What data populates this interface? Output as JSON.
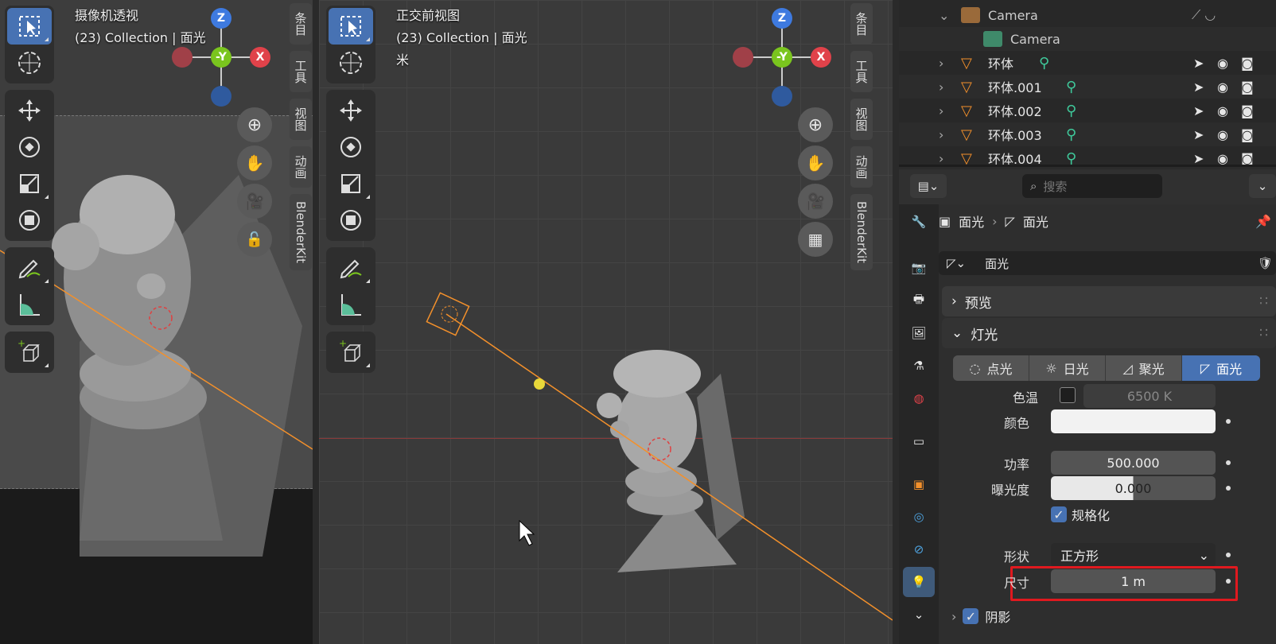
{
  "left_viewport": {
    "title": "摄像机透视",
    "subtitle": "(23) Collection | 面光",
    "side_tabs": [
      "条目",
      "工具",
      "视图",
      "动画",
      "BlenderKit"
    ]
  },
  "mid_viewport": {
    "title": "正交前视图",
    "subtitle": "(23) Collection | 面光",
    "unit": "米",
    "side_tabs": [
      "条目",
      "工具",
      "视图",
      "动画",
      "BlenderKit"
    ]
  },
  "gizmo": {
    "z": "Z",
    "y": "-Y",
    "x": "X"
  },
  "outliner": {
    "rows": [
      {
        "label": "Camera",
        "type": "camera"
      },
      {
        "label": "Camera",
        "type": "camera-data"
      },
      {
        "label": "环体",
        "type": "mesh"
      },
      {
        "label": "环体.001",
        "type": "mesh"
      },
      {
        "label": "环体.002",
        "type": "mesh"
      },
      {
        "label": "环体.003",
        "type": "mesh"
      },
      {
        "label": "环体.004",
        "type": "mesh"
      }
    ]
  },
  "props": {
    "search_placeholder": "搜索",
    "breadcrumb_obj": "面光",
    "breadcrumb_data": "面光",
    "datablock_name": "面光",
    "panel_preview": "预览",
    "panel_light": "灯光",
    "light_types": [
      "点光",
      "日光",
      "聚光",
      "面光"
    ],
    "active_light_type": "面光",
    "color_temp_label": "色温",
    "color_temp_value": "6500 K",
    "color_label": "颜色",
    "power_label": "功率",
    "power_value": "500.000",
    "exposure_label": "曝光度",
    "exposure_value": "0.000",
    "normalize_label": "规格化",
    "shape_label": "形状",
    "shape_value": "正方形",
    "size_label": "尺寸",
    "size_value": "1 m",
    "shadow_label": "阴影"
  },
  "colors": {
    "accent": "#4772b3",
    "highlight": "#e0191f",
    "axis_x": "#e0424a",
    "axis_y": "#7ac51e",
    "axis_z": "#3e7ae0",
    "selection": "#f3902b"
  }
}
